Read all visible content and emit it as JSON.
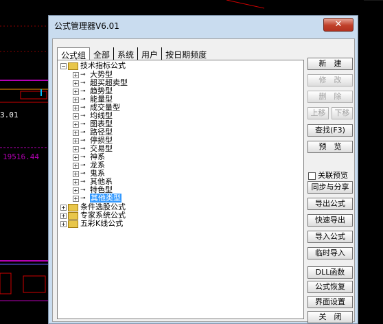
{
  "background": {
    "price_left": "3.01",
    "price_mid": "19516.44"
  },
  "window": {
    "title": "公式管理器V6.01",
    "close_glyph": "✕"
  },
  "tabs": [
    "公式组",
    "全部",
    "系统",
    "用户",
    "按日期频度"
  ],
  "tree": {
    "root": "技术指标公式",
    "children": [
      "大势型",
      "超买超卖型",
      "趋势型",
      "能量型",
      "成交量型",
      "均线型",
      "图表型",
      "路径型",
      "停损型",
      "交易型",
      "神系",
      "龙系",
      "鬼系",
      "其他系",
      "特色型",
      "其他类型"
    ],
    "selected": "其他类型",
    "groups": [
      "条件选股公式",
      "专家系统公式",
      "五彩K线公式"
    ],
    "expander_plus": "+",
    "expander_minus": "−",
    "key_glyph": "⊸"
  },
  "buttons": {
    "new": "新　建",
    "modify": "修　改",
    "delete": "删　除",
    "move_up": "上移",
    "move_down": "下移",
    "find": "查找(F3)",
    "preview": "预　览",
    "linked_preview": "关联预览",
    "sync_share": "同步与分享",
    "export": "导出公式",
    "quick_export": "快速导出",
    "import": "导入公式",
    "temp_import": "临时导入",
    "dll": "DLL函数",
    "restore": "公式恢复",
    "ui_settings": "界面设置",
    "close": "关　闭"
  },
  "colors": {
    "title_bar": "#c9dcef",
    "close_button": "#c0402a",
    "selection": "#3399ff",
    "chart_purple": "#b400b4",
    "chart_red": "#e00000"
  }
}
